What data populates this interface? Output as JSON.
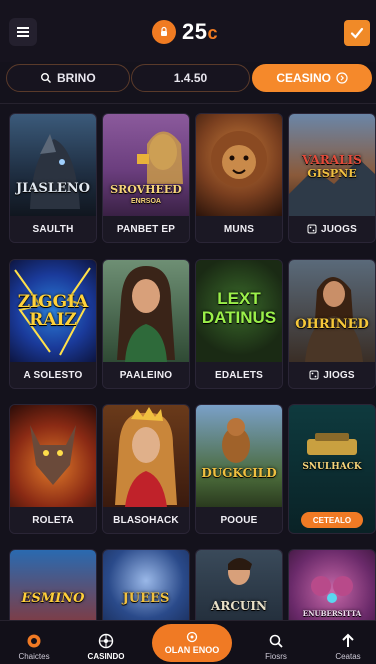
{
  "header": {
    "balance_value": "25",
    "balance_unit": "c",
    "menu_icon": "hamburger-icon",
    "coin_icon": "coin-icon",
    "confirm_icon": "check-icon",
    "accent_color": "#f5892b"
  },
  "tabs": [
    {
      "label": "BRINO",
      "icon": "search-icon"
    },
    {
      "label": "1.4.50"
    },
    {
      "label": "CEASINO",
      "icon": "arrow-right-circle-icon",
      "active": true
    }
  ],
  "games": [
    {
      "art_title": "JIASLENO",
      "label": "SAULTH"
    },
    {
      "art_title": "SROVHEED",
      "art_subtitle": "ENRSOA",
      "label": "PANBET EP"
    },
    {
      "art_title": "",
      "label": "MUNS"
    },
    {
      "art_title": "VARALIS",
      "art_subtitle": "GISPNE",
      "label": "JUOGS",
      "label_icon": "dice-icon"
    },
    {
      "art_title": "ZIGGIA RAIZ",
      "label": "A SOLESTO"
    },
    {
      "art_title": "",
      "label": "PAALEINO"
    },
    {
      "art_title": "LEXT DATINUS",
      "label": "EDALETS"
    },
    {
      "art_title": "OHRINED",
      "label": "JIOGS",
      "label_icon": "dice-icon"
    },
    {
      "art_title": "",
      "label": "ROLETA"
    },
    {
      "art_title": "",
      "label": "BLASOHACK"
    },
    {
      "art_title": "DUGKCILD",
      "label": "POOUE"
    },
    {
      "art_title": "SNULHACK",
      "label": "",
      "button_label": "CETEALO"
    },
    {
      "art_title": "ESMINO",
      "label": ""
    },
    {
      "art_title": "JUEES",
      "label": ""
    },
    {
      "art_title": "ARCUIN",
      "label": ""
    },
    {
      "art_title": "ENUBERSITTA",
      "label": ""
    }
  ],
  "bottom_nav": [
    {
      "label": "Chaictes",
      "icon": "chip-icon"
    },
    {
      "label": "CASINDO",
      "icon": "roulette-icon"
    },
    {
      "label": "OLAN ENOO",
      "icon": "target-icon",
      "active": true
    },
    {
      "label": "Fiosrs",
      "icon": "search-icon"
    },
    {
      "label": "Ceatas",
      "icon": "arrow-up-icon"
    }
  ]
}
